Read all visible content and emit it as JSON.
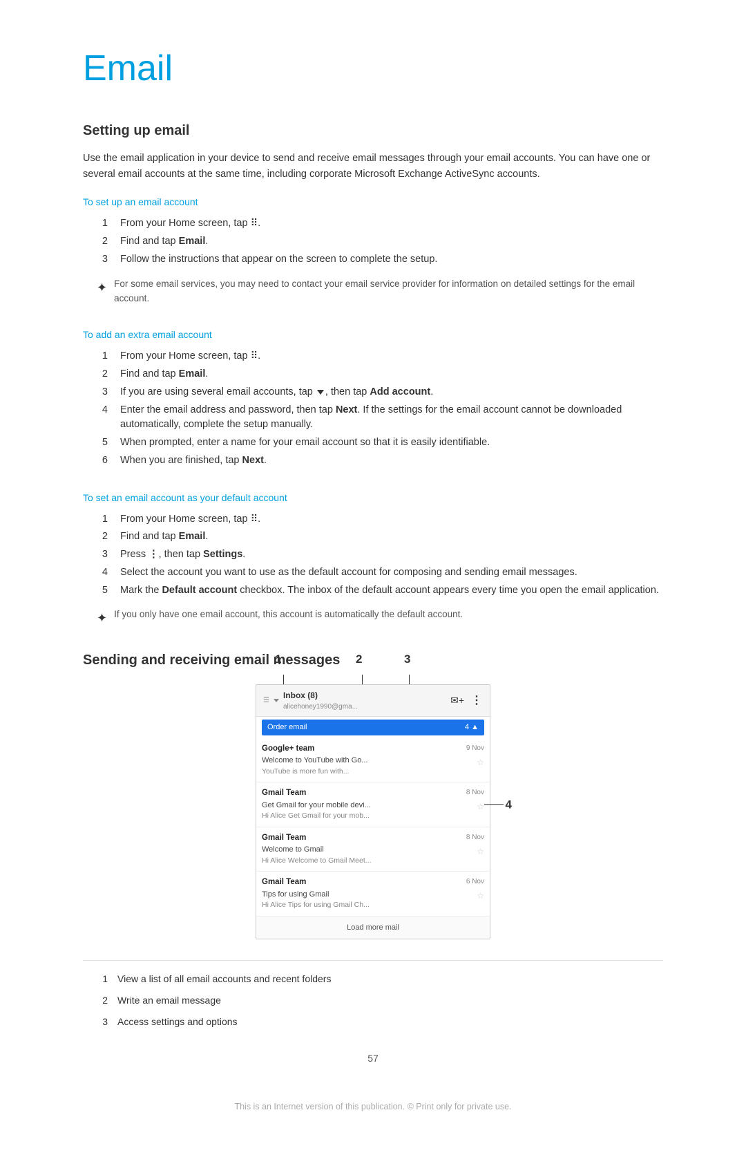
{
  "page": {
    "title": "Email",
    "footer": "This is an Internet version of this publication. © Print only for private use.",
    "page_number": "57"
  },
  "setting_up_email": {
    "heading": "Setting up email",
    "intro": "Use the email application in your device to send and receive email messages through your email accounts. You can have one or several email accounts at the same time, including corporate Microsoft Exchange ActiveSync accounts.",
    "subsections": [
      {
        "link": "To set up an email account",
        "steps": [
          {
            "num": "1",
            "text": "From your Home screen, tap ⠿."
          },
          {
            "num": "2",
            "text": "Find and tap Email."
          },
          {
            "num": "3",
            "text": "Follow the instructions that appear on the screen to complete the setup."
          }
        ],
        "note": "For some email services, you may need to contact your email service provider for information on detailed settings for the email account."
      },
      {
        "link": "To add an extra email account",
        "steps": [
          {
            "num": "1",
            "text": "From your Home screen, tap ⠿."
          },
          {
            "num": "2",
            "text": "Find and tap Email."
          },
          {
            "num": "3",
            "text": "If you are using several email accounts, tap ▾, then tap Add account."
          },
          {
            "num": "4",
            "text": "Enter the email address and password, then tap Next. If the settings for the email account cannot be downloaded automatically, complete the setup manually."
          },
          {
            "num": "5",
            "text": "When prompted, enter a name for your email account so that it is easily identifiable."
          },
          {
            "num": "6",
            "text": "When you are finished, tap Next."
          }
        ],
        "note": null
      },
      {
        "link": "To set an email account as your default account",
        "steps": [
          {
            "num": "1",
            "text": "From your Home screen, tap ⠿."
          },
          {
            "num": "2",
            "text": "Find and tap Email."
          },
          {
            "num": "3",
            "text": "Press ⋮, then tap Settings."
          },
          {
            "num": "4",
            "text": "Select the account you want to use as the default account for composing and sending email messages."
          },
          {
            "num": "5",
            "text": "Mark the Default account checkbox. The inbox of the default account appears every time you open the email application."
          }
        ],
        "note": "If you only have one email account, this account is automatically the default account."
      }
    ]
  },
  "sending_section": {
    "heading": "Sending and receiving email messages",
    "screenshot": {
      "inbox_label": "Inbox (8)",
      "account": "alicehoney1990@gma...",
      "order_email": "Order email",
      "order_date": "4▲",
      "emails": [
        {
          "from": "Google+ team",
          "date": "9 Nov",
          "subject": "Welcome to YouTube with Go...",
          "preview": "YouTube is more fun with...",
          "starred": false
        },
        {
          "from": "Gmail Team",
          "date": "8 Nov",
          "subject": "Get Gmail for your mobile devi...",
          "preview": "Hi Alice Get Gmail for your mob...",
          "starred": false
        },
        {
          "from": "Gmail Team",
          "date": "8 Nov",
          "subject": "Welcome to Gmail",
          "preview": "Hi Alice Welcome to Gmail Meet...",
          "starred": false
        },
        {
          "from": "Gmail Team",
          "date": "6 Nov",
          "subject": "Tips for using Gmail",
          "preview": "Hi Alice Tips for using Gmail Ch...",
          "starred": false
        }
      ],
      "load_more": "Load more mail"
    },
    "callouts": [
      {
        "num": "1",
        "text": "View a list of all email accounts and recent folders"
      },
      {
        "num": "2",
        "text": "Write an email message"
      },
      {
        "num": "3",
        "text": "Access settings and options"
      }
    ],
    "num_labels": {
      "1": "1",
      "2": "2",
      "3": "3",
      "4": "4"
    }
  }
}
